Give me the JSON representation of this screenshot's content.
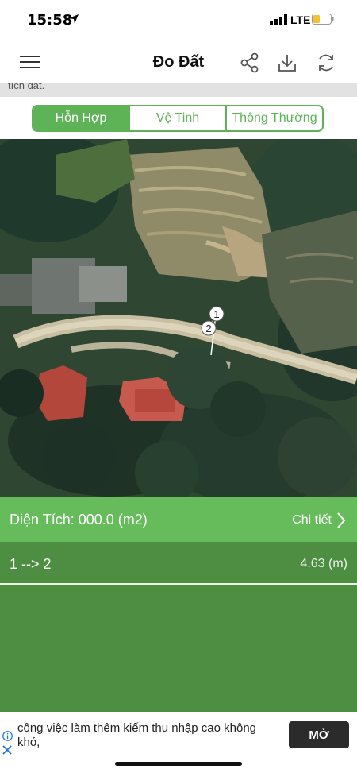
{
  "status": {
    "time": "15:58",
    "network": "LTE",
    "icons": [
      "location-arrow-icon",
      "signal-icon",
      "battery-icon"
    ]
  },
  "nav": {
    "title": "Đo Đất",
    "icons": [
      "menu-icon",
      "share-icon",
      "download-icon",
      "refresh-icon"
    ]
  },
  "note": {
    "text": "tích đất."
  },
  "segments": {
    "items": [
      "Hỗn Hợp",
      "Vệ Tinh",
      "Thông Thường"
    ],
    "active": "Hỗn Hợp"
  },
  "map": {
    "markers": [
      "1",
      "2"
    ]
  },
  "area": {
    "text": "Diện Tích: 000.0 (m2)",
    "detail": "Chi tiết"
  },
  "segments_list": [
    {
      "label": "1 --> 2",
      "length": "4.63 (m)"
    }
  ],
  "ad": {
    "text": "công việc làm thêm kiếm thu nhập cao không khó,",
    "button": "MỞ"
  },
  "colors": {
    "accent": "#5db356",
    "area_bar": "#66bb5a",
    "list_bg": "#4e8e43"
  }
}
